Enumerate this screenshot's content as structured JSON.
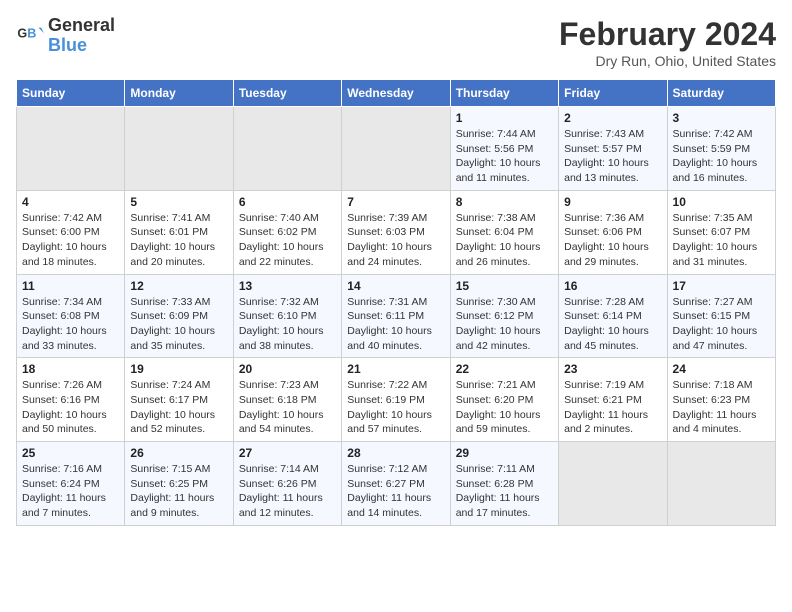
{
  "header": {
    "logo_line1": "General",
    "logo_line2": "Blue",
    "main_title": "February 2024",
    "subtitle": "Dry Run, Ohio, United States"
  },
  "columns": [
    "Sunday",
    "Monday",
    "Tuesday",
    "Wednesday",
    "Thursday",
    "Friday",
    "Saturday"
  ],
  "weeks": [
    [
      {
        "day": "",
        "info": ""
      },
      {
        "day": "",
        "info": ""
      },
      {
        "day": "",
        "info": ""
      },
      {
        "day": "",
        "info": ""
      },
      {
        "day": "1",
        "info": "Sunrise: 7:44 AM\nSunset: 5:56 PM\nDaylight: 10 hours\nand 11 minutes."
      },
      {
        "day": "2",
        "info": "Sunrise: 7:43 AM\nSunset: 5:57 PM\nDaylight: 10 hours\nand 13 minutes."
      },
      {
        "day": "3",
        "info": "Sunrise: 7:42 AM\nSunset: 5:59 PM\nDaylight: 10 hours\nand 16 minutes."
      }
    ],
    [
      {
        "day": "4",
        "info": "Sunrise: 7:42 AM\nSunset: 6:00 PM\nDaylight: 10 hours\nand 18 minutes."
      },
      {
        "day": "5",
        "info": "Sunrise: 7:41 AM\nSunset: 6:01 PM\nDaylight: 10 hours\nand 20 minutes."
      },
      {
        "day": "6",
        "info": "Sunrise: 7:40 AM\nSunset: 6:02 PM\nDaylight: 10 hours\nand 22 minutes."
      },
      {
        "day": "7",
        "info": "Sunrise: 7:39 AM\nSunset: 6:03 PM\nDaylight: 10 hours\nand 24 minutes."
      },
      {
        "day": "8",
        "info": "Sunrise: 7:38 AM\nSunset: 6:04 PM\nDaylight: 10 hours\nand 26 minutes."
      },
      {
        "day": "9",
        "info": "Sunrise: 7:36 AM\nSunset: 6:06 PM\nDaylight: 10 hours\nand 29 minutes."
      },
      {
        "day": "10",
        "info": "Sunrise: 7:35 AM\nSunset: 6:07 PM\nDaylight: 10 hours\nand 31 minutes."
      }
    ],
    [
      {
        "day": "11",
        "info": "Sunrise: 7:34 AM\nSunset: 6:08 PM\nDaylight: 10 hours\nand 33 minutes."
      },
      {
        "day": "12",
        "info": "Sunrise: 7:33 AM\nSunset: 6:09 PM\nDaylight: 10 hours\nand 35 minutes."
      },
      {
        "day": "13",
        "info": "Sunrise: 7:32 AM\nSunset: 6:10 PM\nDaylight: 10 hours\nand 38 minutes."
      },
      {
        "day": "14",
        "info": "Sunrise: 7:31 AM\nSunset: 6:11 PM\nDaylight: 10 hours\nand 40 minutes."
      },
      {
        "day": "15",
        "info": "Sunrise: 7:30 AM\nSunset: 6:12 PM\nDaylight: 10 hours\nand 42 minutes."
      },
      {
        "day": "16",
        "info": "Sunrise: 7:28 AM\nSunset: 6:14 PM\nDaylight: 10 hours\nand 45 minutes."
      },
      {
        "day": "17",
        "info": "Sunrise: 7:27 AM\nSunset: 6:15 PM\nDaylight: 10 hours\nand 47 minutes."
      }
    ],
    [
      {
        "day": "18",
        "info": "Sunrise: 7:26 AM\nSunset: 6:16 PM\nDaylight: 10 hours\nand 50 minutes."
      },
      {
        "day": "19",
        "info": "Sunrise: 7:24 AM\nSunset: 6:17 PM\nDaylight: 10 hours\nand 52 minutes."
      },
      {
        "day": "20",
        "info": "Sunrise: 7:23 AM\nSunset: 6:18 PM\nDaylight: 10 hours\nand 54 minutes."
      },
      {
        "day": "21",
        "info": "Sunrise: 7:22 AM\nSunset: 6:19 PM\nDaylight: 10 hours\nand 57 minutes."
      },
      {
        "day": "22",
        "info": "Sunrise: 7:21 AM\nSunset: 6:20 PM\nDaylight: 10 hours\nand 59 minutes."
      },
      {
        "day": "23",
        "info": "Sunrise: 7:19 AM\nSunset: 6:21 PM\nDaylight: 11 hours\nand 2 minutes."
      },
      {
        "day": "24",
        "info": "Sunrise: 7:18 AM\nSunset: 6:23 PM\nDaylight: 11 hours\nand 4 minutes."
      }
    ],
    [
      {
        "day": "25",
        "info": "Sunrise: 7:16 AM\nSunset: 6:24 PM\nDaylight: 11 hours\nand 7 minutes."
      },
      {
        "day": "26",
        "info": "Sunrise: 7:15 AM\nSunset: 6:25 PM\nDaylight: 11 hours\nand 9 minutes."
      },
      {
        "day": "27",
        "info": "Sunrise: 7:14 AM\nSunset: 6:26 PM\nDaylight: 11 hours\nand 12 minutes."
      },
      {
        "day": "28",
        "info": "Sunrise: 7:12 AM\nSunset: 6:27 PM\nDaylight: 11 hours\nand 14 minutes."
      },
      {
        "day": "29",
        "info": "Sunrise: 7:11 AM\nSunset: 6:28 PM\nDaylight: 11 hours\nand 17 minutes."
      },
      {
        "day": "",
        "info": ""
      },
      {
        "day": "",
        "info": ""
      }
    ]
  ]
}
